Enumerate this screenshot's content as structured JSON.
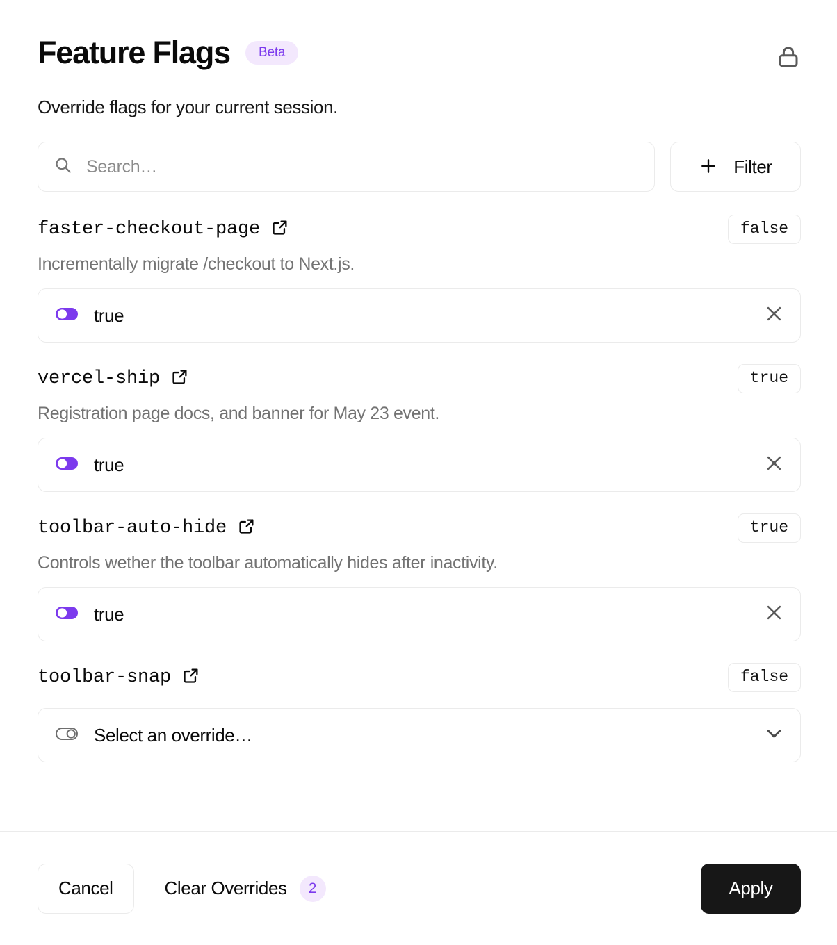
{
  "header": {
    "title": "Feature Flags",
    "badge": "Beta",
    "lock_icon": "lock-icon"
  },
  "subtitle": "Override flags for your current session.",
  "search": {
    "placeholder": "Search…",
    "value": "",
    "icon": "search-icon"
  },
  "filter": {
    "label": "Filter",
    "icon": "plus-icon"
  },
  "flags": [
    {
      "name": "faster-checkout-page",
      "description": "Incrementally migrate /checkout to Next.js.",
      "value_badge": "false",
      "override": {
        "type": "toggle",
        "label": "true",
        "state": "on",
        "toggle_icon": "toggle-on-icon",
        "action_icon": "close-icon"
      }
    },
    {
      "name": "vercel-ship",
      "description": "Registration page  docs, and banner for May 23 event.",
      "value_badge": "true",
      "override": {
        "type": "toggle",
        "label": "true",
        "state": "on",
        "toggle_icon": "toggle-on-icon",
        "action_icon": "close-icon"
      }
    },
    {
      "name": "toolbar-auto-hide",
      "description": "Controls wether the toolbar automatically hides after inactivity.",
      "value_badge": "true",
      "override": {
        "type": "toggle",
        "label": "true",
        "state": "on",
        "toggle_icon": "toggle-on-icon",
        "action_icon": "close-icon"
      }
    },
    {
      "name": "toolbar-snap",
      "description": "",
      "value_badge": "false",
      "override": {
        "type": "select",
        "label": "Select an override…",
        "state": "off",
        "toggle_icon": "toggle-off-icon",
        "action_icon": "chevron-down-icon"
      }
    }
  ],
  "footer": {
    "cancel_label": "Cancel",
    "clear_overrides_label": "Clear Overrides",
    "clear_overrides_count": "2",
    "apply_label": "Apply"
  },
  "colors": {
    "accent": "#7c3aed",
    "accent_soft": "#f3e8fd",
    "border": "#ebebeb",
    "text": "#0a0a0a",
    "muted": "#737373",
    "apply_bg": "#171717"
  }
}
